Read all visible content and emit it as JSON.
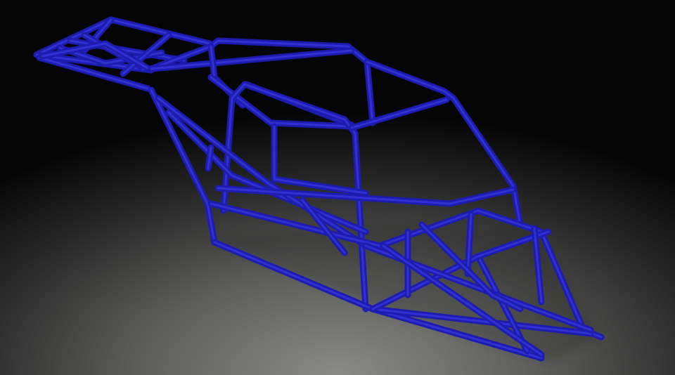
{
  "scene": {
    "subject": "tube-frame-chassis",
    "tube_color": "#1c1cb0",
    "tube_highlight": "#3a3ae0",
    "background_top": "#050505",
    "background_bottom": "#8a8a86"
  }
}
